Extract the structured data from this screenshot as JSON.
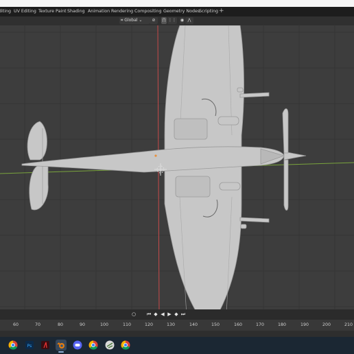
{
  "workspace_tabs": [
    "diting",
    "UV Editing",
    "Texture Paint",
    "Shading",
    "Animation",
    "Rendering",
    "Compositing",
    "Geometry Nodes",
    "Scripting"
  ],
  "add_tab_label": "+",
  "viewport_header": {
    "orientation_label": "Global",
    "proportional_icon": "proportional-edit-icon"
  },
  "timeline": {
    "frames": [
      "60",
      "70",
      "80",
      "90",
      "100",
      "110",
      "120",
      "130",
      "140",
      "150",
      "160",
      "170",
      "180",
      "190",
      "200",
      "210"
    ],
    "playback_buttons": [
      "record",
      "jump-start",
      "prev-keyframe",
      "play-reverse",
      "play",
      "next-keyframe",
      "jump-end"
    ]
  },
  "taskbar": {
    "apps": [
      "Chrome",
      "Photoshop",
      "Adobe",
      "Blender",
      "Discord",
      "Chrome",
      "Kdenlive",
      "Chrome"
    ]
  },
  "colors": {
    "viewport_bg": "#3d3d3d",
    "grid": "#353535",
    "x_axis": "#c74a4a",
    "y_axis": "#7aa53d",
    "model": "#c7c7c7",
    "topbar": "#1d1d1d",
    "taskbar": "#1b2733"
  }
}
